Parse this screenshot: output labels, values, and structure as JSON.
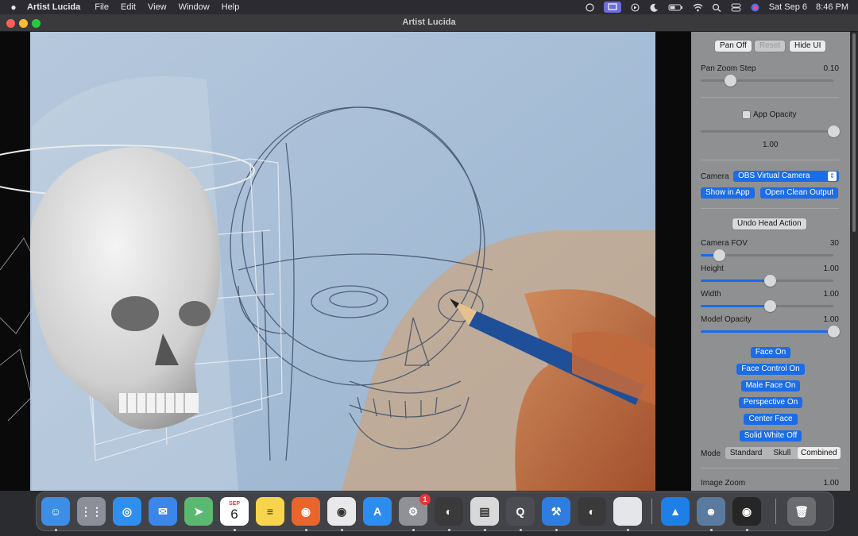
{
  "menubar": {
    "app_name": "Artist Lucida",
    "menus": [
      "File",
      "Edit",
      "View",
      "Window",
      "Help"
    ],
    "date": "Sat Sep 6",
    "time": "8:46 PM"
  },
  "window": {
    "title": "Artist Lucida"
  },
  "panel": {
    "top_buttons": {
      "pan": "Pan Off",
      "reset": "Reset",
      "hide_ui": "Hide UI"
    },
    "pan_zoom_step": {
      "label": "Pan Zoom Step",
      "value": "0.10",
      "fraction": 0.22
    },
    "app_opacity": {
      "label": "App Opacity",
      "value": "1.00",
      "checked": false,
      "fraction": 1.0
    },
    "camera": {
      "label": "Camera",
      "selected": "OBS Virtual Camera"
    },
    "camera_buttons": {
      "show_in_app": "Show in App",
      "open_clean_output": "Open Clean Output"
    },
    "undo_head": "Undo Head Action",
    "camera_fov": {
      "label": "Camera FOV",
      "value": "30",
      "fraction": 0.14
    },
    "height": {
      "label": "Height",
      "value": "1.00",
      "fraction": 0.52
    },
    "width": {
      "label": "Width",
      "value": "1.00",
      "fraction": 0.52
    },
    "model_opacity": {
      "label": "Model Opacity",
      "value": "1.00",
      "fraction": 1.0
    },
    "toggles": [
      "Face On",
      "Face Control On",
      "Male Face On",
      "Perspective On",
      "Center Face",
      "Solid White Off"
    ],
    "mode": {
      "label": "Mode",
      "options": [
        "Standard",
        "Skull",
        "Combined"
      ],
      "selected": "Combined"
    },
    "image_zoom": {
      "label": "Image Zoom",
      "value": "1.00"
    }
  },
  "dock": {
    "apps": [
      {
        "name": "Finder",
        "icon": "finder-icon",
        "color": "#3d8ee6",
        "glyph": "☺"
      },
      {
        "name": "Launchpad",
        "icon": "launchpad-icon",
        "color": "#8c8f99",
        "glyph": "⋮⋮"
      },
      {
        "name": "Safari",
        "icon": "safari-icon",
        "color": "#2f8ff0",
        "glyph": "◎"
      },
      {
        "name": "Mail",
        "icon": "mail-icon",
        "color": "#3b86e8",
        "glyph": "✉"
      },
      {
        "name": "Maps",
        "icon": "maps-icon",
        "color": "#5bb870",
        "glyph": "➤"
      },
      {
        "name": "Calendar",
        "icon": "calendar-icon",
        "color": "#ffffff",
        "glyph": "6",
        "month": "SEP"
      },
      {
        "name": "Notes",
        "icon": "notes-icon",
        "color": "#f8d44c",
        "glyph": "≡"
      },
      {
        "name": "Firefox",
        "icon": "firefox-icon",
        "color": "#e8652b",
        "glyph": "◉"
      },
      {
        "name": "Chrome",
        "icon": "chrome-icon",
        "color": "#e9e9e9",
        "glyph": "◉"
      },
      {
        "name": "App Store",
        "icon": "app-store-icon",
        "color": "#2d8cf0",
        "glyph": "A"
      },
      {
        "name": "System Settings",
        "icon": "system-settings-icon",
        "color": "#8f9197",
        "glyph": "⚙",
        "badge": "1"
      },
      {
        "name": "Blender",
        "icon": "blender-icon",
        "color": "#3a3a3a",
        "glyph": "◐"
      },
      {
        "name": "Preview",
        "icon": "preview-icon",
        "color": "#d9d9d9",
        "glyph": "▤"
      },
      {
        "name": "QuickTime",
        "icon": "quicktime-icon",
        "color": "#4b4d52",
        "glyph": "Q"
      },
      {
        "name": "Xcode",
        "icon": "xcode-icon",
        "color": "#2f7de0",
        "glyph": "⚒"
      },
      {
        "name": "Blender",
        "icon": "blender-icon",
        "color": "#3a3a3a",
        "glyph": "◐"
      },
      {
        "name": "Blank",
        "icon": "blank-app-icon",
        "color": "#e4e6ea",
        "glyph": ""
      },
      {
        "name": "Artist Lucida Shortcut",
        "icon": "lucida-icon",
        "color": "#1e7fe6",
        "glyph": "▲"
      },
      {
        "name": "Artist Lucida",
        "icon": "face-model-icon",
        "color": "#5b7aa0",
        "glyph": "☻"
      },
      {
        "name": "OBS",
        "icon": "obs-icon",
        "color": "#262626",
        "glyph": "◉"
      },
      {
        "name": "Trash",
        "icon": "trash-icon",
        "color": "#6a6c70",
        "glyph": "🗑"
      }
    ]
  }
}
